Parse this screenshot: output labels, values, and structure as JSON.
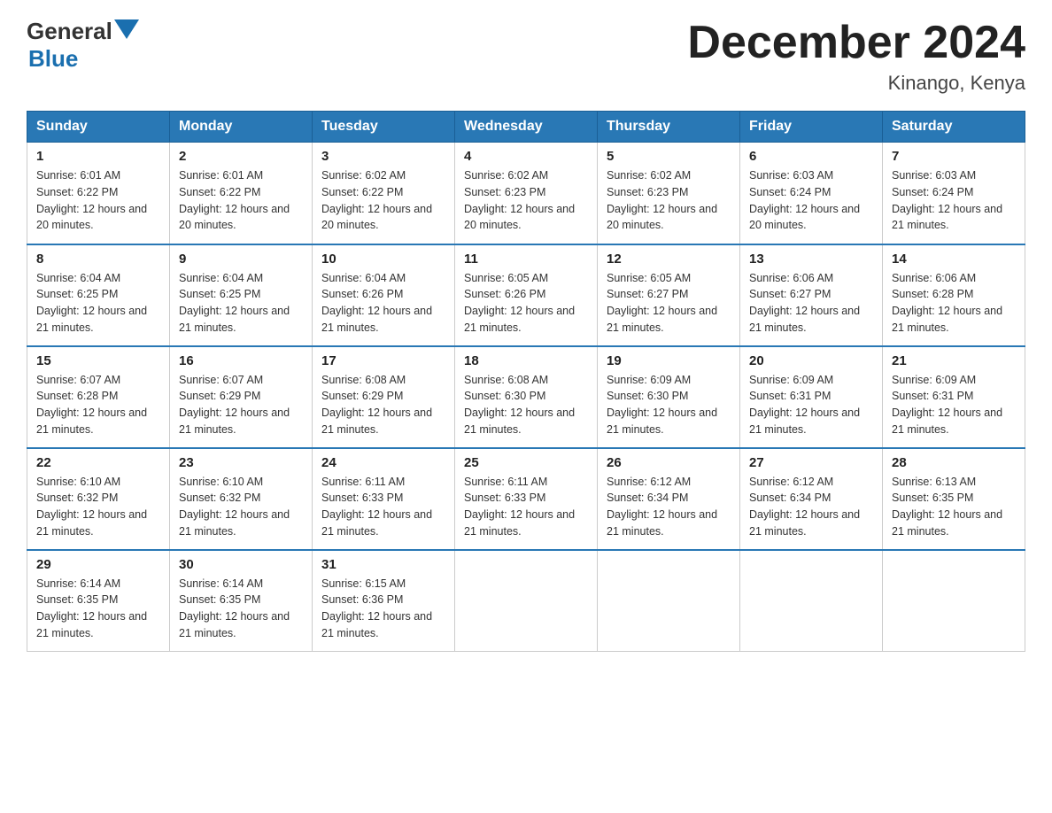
{
  "header": {
    "logo": {
      "general": "General",
      "blue": "Blue",
      "alt": "GeneralBlue logo"
    },
    "title": "December 2024",
    "subtitle": "Kinango, Kenya"
  },
  "calendar": {
    "days_of_week": [
      "Sunday",
      "Monday",
      "Tuesday",
      "Wednesday",
      "Thursday",
      "Friday",
      "Saturday"
    ],
    "weeks": [
      [
        {
          "day": "1",
          "sunrise": "Sunrise: 6:01 AM",
          "sunset": "Sunset: 6:22 PM",
          "daylight": "Daylight: 12 hours and 20 minutes."
        },
        {
          "day": "2",
          "sunrise": "Sunrise: 6:01 AM",
          "sunset": "Sunset: 6:22 PM",
          "daylight": "Daylight: 12 hours and 20 minutes."
        },
        {
          "day": "3",
          "sunrise": "Sunrise: 6:02 AM",
          "sunset": "Sunset: 6:22 PM",
          "daylight": "Daylight: 12 hours and 20 minutes."
        },
        {
          "day": "4",
          "sunrise": "Sunrise: 6:02 AM",
          "sunset": "Sunset: 6:23 PM",
          "daylight": "Daylight: 12 hours and 20 minutes."
        },
        {
          "day": "5",
          "sunrise": "Sunrise: 6:02 AM",
          "sunset": "Sunset: 6:23 PM",
          "daylight": "Daylight: 12 hours and 20 minutes."
        },
        {
          "day": "6",
          "sunrise": "Sunrise: 6:03 AM",
          "sunset": "Sunset: 6:24 PM",
          "daylight": "Daylight: 12 hours and 20 minutes."
        },
        {
          "day": "7",
          "sunrise": "Sunrise: 6:03 AM",
          "sunset": "Sunset: 6:24 PM",
          "daylight": "Daylight: 12 hours and 21 minutes."
        }
      ],
      [
        {
          "day": "8",
          "sunrise": "Sunrise: 6:04 AM",
          "sunset": "Sunset: 6:25 PM",
          "daylight": "Daylight: 12 hours and 21 minutes."
        },
        {
          "day": "9",
          "sunrise": "Sunrise: 6:04 AM",
          "sunset": "Sunset: 6:25 PM",
          "daylight": "Daylight: 12 hours and 21 minutes."
        },
        {
          "day": "10",
          "sunrise": "Sunrise: 6:04 AM",
          "sunset": "Sunset: 6:26 PM",
          "daylight": "Daylight: 12 hours and 21 minutes."
        },
        {
          "day": "11",
          "sunrise": "Sunrise: 6:05 AM",
          "sunset": "Sunset: 6:26 PM",
          "daylight": "Daylight: 12 hours and 21 minutes."
        },
        {
          "day": "12",
          "sunrise": "Sunrise: 6:05 AM",
          "sunset": "Sunset: 6:27 PM",
          "daylight": "Daylight: 12 hours and 21 minutes."
        },
        {
          "day": "13",
          "sunrise": "Sunrise: 6:06 AM",
          "sunset": "Sunset: 6:27 PM",
          "daylight": "Daylight: 12 hours and 21 minutes."
        },
        {
          "day": "14",
          "sunrise": "Sunrise: 6:06 AM",
          "sunset": "Sunset: 6:28 PM",
          "daylight": "Daylight: 12 hours and 21 minutes."
        }
      ],
      [
        {
          "day": "15",
          "sunrise": "Sunrise: 6:07 AM",
          "sunset": "Sunset: 6:28 PM",
          "daylight": "Daylight: 12 hours and 21 minutes."
        },
        {
          "day": "16",
          "sunrise": "Sunrise: 6:07 AM",
          "sunset": "Sunset: 6:29 PM",
          "daylight": "Daylight: 12 hours and 21 minutes."
        },
        {
          "day": "17",
          "sunrise": "Sunrise: 6:08 AM",
          "sunset": "Sunset: 6:29 PM",
          "daylight": "Daylight: 12 hours and 21 minutes."
        },
        {
          "day": "18",
          "sunrise": "Sunrise: 6:08 AM",
          "sunset": "Sunset: 6:30 PM",
          "daylight": "Daylight: 12 hours and 21 minutes."
        },
        {
          "day": "19",
          "sunrise": "Sunrise: 6:09 AM",
          "sunset": "Sunset: 6:30 PM",
          "daylight": "Daylight: 12 hours and 21 minutes."
        },
        {
          "day": "20",
          "sunrise": "Sunrise: 6:09 AM",
          "sunset": "Sunset: 6:31 PM",
          "daylight": "Daylight: 12 hours and 21 minutes."
        },
        {
          "day": "21",
          "sunrise": "Sunrise: 6:09 AM",
          "sunset": "Sunset: 6:31 PM",
          "daylight": "Daylight: 12 hours and 21 minutes."
        }
      ],
      [
        {
          "day": "22",
          "sunrise": "Sunrise: 6:10 AM",
          "sunset": "Sunset: 6:32 PM",
          "daylight": "Daylight: 12 hours and 21 minutes."
        },
        {
          "day": "23",
          "sunrise": "Sunrise: 6:10 AM",
          "sunset": "Sunset: 6:32 PM",
          "daylight": "Daylight: 12 hours and 21 minutes."
        },
        {
          "day": "24",
          "sunrise": "Sunrise: 6:11 AM",
          "sunset": "Sunset: 6:33 PM",
          "daylight": "Daylight: 12 hours and 21 minutes."
        },
        {
          "day": "25",
          "sunrise": "Sunrise: 6:11 AM",
          "sunset": "Sunset: 6:33 PM",
          "daylight": "Daylight: 12 hours and 21 minutes."
        },
        {
          "day": "26",
          "sunrise": "Sunrise: 6:12 AM",
          "sunset": "Sunset: 6:34 PM",
          "daylight": "Daylight: 12 hours and 21 minutes."
        },
        {
          "day": "27",
          "sunrise": "Sunrise: 6:12 AM",
          "sunset": "Sunset: 6:34 PM",
          "daylight": "Daylight: 12 hours and 21 minutes."
        },
        {
          "day": "28",
          "sunrise": "Sunrise: 6:13 AM",
          "sunset": "Sunset: 6:35 PM",
          "daylight": "Daylight: 12 hours and 21 minutes."
        }
      ],
      [
        {
          "day": "29",
          "sunrise": "Sunrise: 6:14 AM",
          "sunset": "Sunset: 6:35 PM",
          "daylight": "Daylight: 12 hours and 21 minutes."
        },
        {
          "day": "30",
          "sunrise": "Sunrise: 6:14 AM",
          "sunset": "Sunset: 6:35 PM",
          "daylight": "Daylight: 12 hours and 21 minutes."
        },
        {
          "day": "31",
          "sunrise": "Sunrise: 6:15 AM",
          "sunset": "Sunset: 6:36 PM",
          "daylight": "Daylight: 12 hours and 21 minutes."
        },
        null,
        null,
        null,
        null
      ]
    ]
  }
}
